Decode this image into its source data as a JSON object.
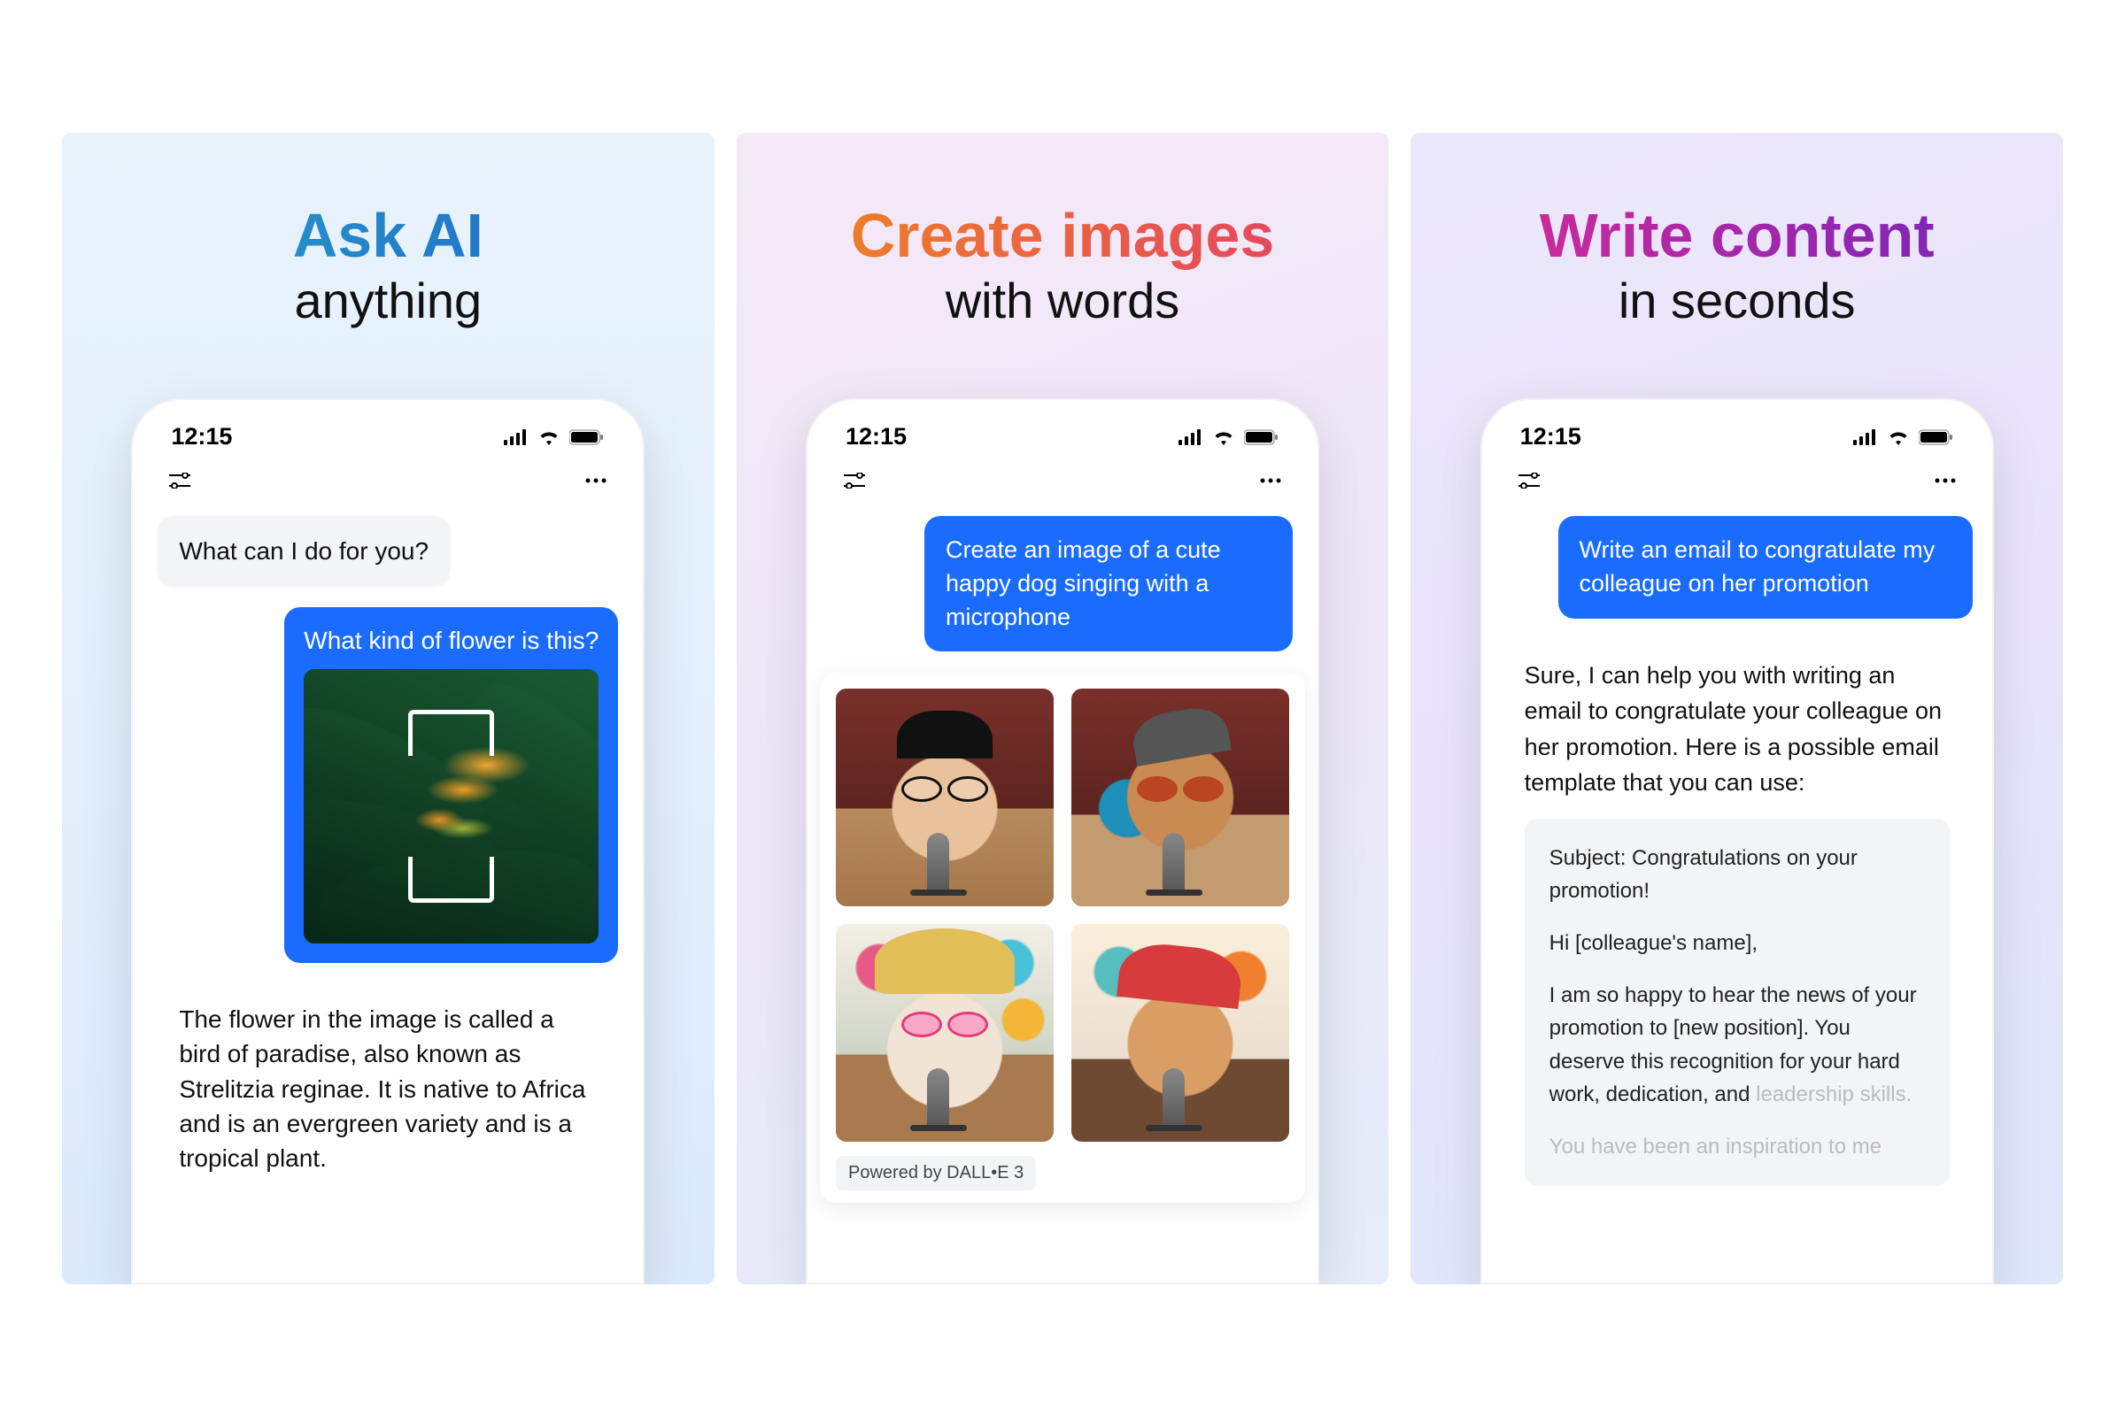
{
  "status": {
    "time": "12:15"
  },
  "panels": [
    {
      "headline_top": "Ask AI",
      "headline_sub": "anything",
      "ai_greeting": "What can I do for you?",
      "user_prompt": "What kind of flower is this?",
      "ai_answer": "The flower in the image is called a bird of paradise, also known as Strelitzia reginae. It is native to Africa and is an evergreen variety and is a tropical plant."
    },
    {
      "headline_top": "Create images",
      "headline_sub": "with words",
      "user_prompt": "Create an image of a cute happy dog singing with a microphone",
      "attribution": "Powered by DALL•E 3"
    },
    {
      "headline_top": "Write content",
      "headline_sub": "in seconds",
      "user_prompt": "Write an email to congratulate my colleague on her promotion",
      "ai_intro": "Sure, I can help you with writing an email to congratulate your colleague on her promotion. Here is a possible email template that you can use:",
      "email": {
        "subject": "Subject: Congratulations on your promotion!",
        "greeting": "Hi [colleague's name],",
        "body1": "I am so happy to hear the news of your promotion to [new position]. You deserve this recognition for your hard work, dedication, and",
        "body1_fade": "leadership skills.",
        "body2_fade": "You have been an inspiration to me"
      }
    }
  ]
}
